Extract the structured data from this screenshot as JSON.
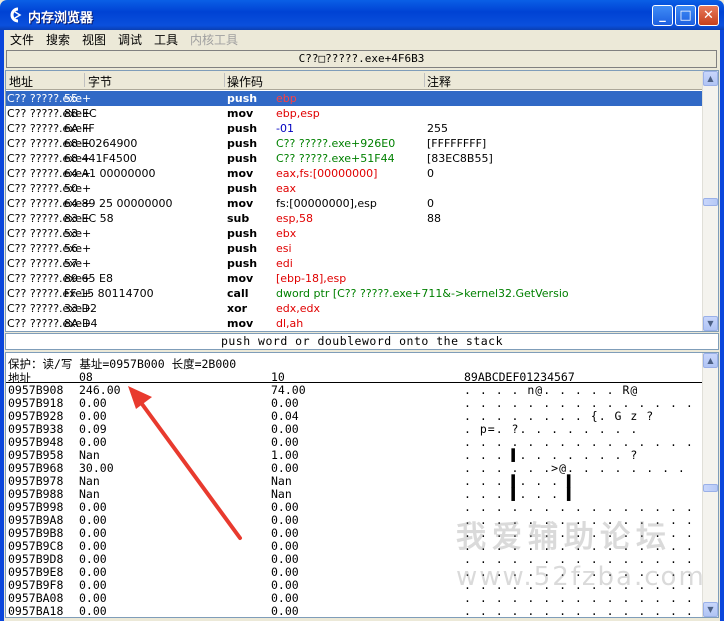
{
  "window": {
    "title": "内存浏览器",
    "minimize_glyph": "_",
    "maximize_glyph": "□",
    "close_glyph": "✕"
  },
  "menu": [
    "文件",
    "搜索",
    "视图",
    "调试",
    "工具",
    "内核工具"
  ],
  "address_bar": "C??□?????.exe+4F6B3",
  "disasm": {
    "headers": {
      "address": "地址",
      "bytes": "字节",
      "opcode": "操作码",
      "comment": "注释"
    },
    "rows": [
      {
        "addr": "C?? ?????.exe+",
        "bytes": "55",
        "op": "push",
        "args": "ebp",
        "comment": ""
      },
      {
        "addr": "C?? ?????.exe+",
        "bytes": "8B EC",
        "op": "mov",
        "args": "ebp,esp",
        "comment": ""
      },
      {
        "addr": "C?? ?????.exe+",
        "bytes": "6A FF",
        "op": "push",
        "args": "-01",
        "comment": "255"
      },
      {
        "addr": "C?? ?????.exe+",
        "bytes": "68 E0264900",
        "op": "push",
        "args": "C?? ?????.exe+926E0",
        "comment": "[FFFFFFFF]"
      },
      {
        "addr": "C?? ?????.exe+",
        "bytes": "68 441F4500",
        "op": "push",
        "args": "C?? ?????.exe+51F44",
        "comment": "[83EC8B55]"
      },
      {
        "addr": "C?? ?????.exe+",
        "bytes": "64 A1 00000000",
        "op": "mov",
        "args": "eax,fs:[00000000]",
        "comment": "0"
      },
      {
        "addr": "C?? ?????.exe+",
        "bytes": "50",
        "op": "push",
        "args": "eax",
        "comment": ""
      },
      {
        "addr": "C?? ?????.exe+",
        "bytes": "64 89 25 00000000",
        "op": "mov",
        "args": "fs:[00000000],esp",
        "comment": "0"
      },
      {
        "addr": "C?? ?????.exe+",
        "bytes": "83 EC 58",
        "op": "sub",
        "args": "esp,58",
        "comment": "88"
      },
      {
        "addr": "C?? ?????.exe+",
        "bytes": "53",
        "op": "push",
        "args": "ebx",
        "comment": ""
      },
      {
        "addr": "C?? ?????.exe+",
        "bytes": "56",
        "op": "push",
        "args": "esi",
        "comment": ""
      },
      {
        "addr": "C?? ?????.exe+",
        "bytes": "57",
        "op": "push",
        "args": "edi",
        "comment": ""
      },
      {
        "addr": "C?? ?????.exe+",
        "bytes": "89 65 E8",
        "op": "mov",
        "args": "[ebp-18],esp",
        "comment": ""
      },
      {
        "addr": "C?? ?????.exe+",
        "bytes": "FF 15 80114700",
        "op": "call",
        "args": "dword ptr [C?? ?????.exe+711&->kernel32.GetVersio",
        "comment": ""
      },
      {
        "addr": "C?? ?????.exe+",
        "bytes": "33 D2",
        "op": "xor",
        "args": "edx,edx",
        "comment": ""
      },
      {
        "addr": "C?? ?????.exe+",
        "bytes": "8A D4",
        "op": "mov",
        "args": "dl,ah",
        "comment": ""
      }
    ]
  },
  "description": "push word or doubleword onto the stack",
  "hex": {
    "protection": "保护：读/写   基址=0957B000 长度=2B000",
    "headers": {
      "address": "地址",
      "col1": "08",
      "col2": "10",
      "ascii": "89ABCDEF01234567"
    },
    "rows": [
      {
        "addr": "0957B908",
        "v1": "246.00",
        "v2": "74.00",
        "ascii": ". . . . n@. . . . . R@"
      },
      {
        "addr": "0957B918",
        "v1": "0.00",
        "v2": "0.00",
        "ascii": ". . . . . . . . . . . . . . . ."
      },
      {
        "addr": "0957B928",
        "v1": "0.00",
        "v2": "0.04",
        "ascii": ". . . . . . . . {. G z ?"
      },
      {
        "addr": "0957B938",
        "v1": "0.09",
        "v2": "0.00",
        "ascii": ".  p=. ?. . . . . . . ."
      },
      {
        "addr": "0957B948",
        "v1": "0.00",
        "v2": "0.00",
        "ascii": ". . . . . . . . . . . . . . . ."
      },
      {
        "addr": "0957B958",
        "v1": "Nan",
        "v2": "1.00",
        "ascii": ". . .  ▌. . . . . . . ?"
      },
      {
        "addr": "0957B968",
        "v1": "30.00",
        "v2": "0.00",
        "ascii": ". . . . . .>@. . . . . . . ."
      },
      {
        "addr": "0957B978",
        "v1": "Nan",
        "v2": "Nan",
        "ascii": ". . .  ▌. . .     ▌"
      },
      {
        "addr": "0957B988",
        "v1": "Nan",
        "v2": "Nan",
        "ascii": ". . .  ▌. . .     ▌"
      },
      {
        "addr": "0957B998",
        "v1": "0.00",
        "v2": "0.00",
        "ascii": ". . . . . . . . . . . . . . . ."
      },
      {
        "addr": "0957B9A8",
        "v1": "0.00",
        "v2": "0.00",
        "ascii": ". . . . . . . . . . . . . . . ."
      },
      {
        "addr": "0957B9B8",
        "v1": "0.00",
        "v2": "0.00",
        "ascii": ". . . . . . . . . . . . . . . ."
      },
      {
        "addr": "0957B9C8",
        "v1": "0.00",
        "v2": "0.00",
        "ascii": ". . . . . . . . . . . . . . . ."
      },
      {
        "addr": "0957B9D8",
        "v1": "0.00",
        "v2": "0.00",
        "ascii": ". . . . . . . . . . . . . . . ."
      },
      {
        "addr": "0957B9E8",
        "v1": "0.00",
        "v2": "0.00",
        "ascii": ". . . . . . . . . . . . . . . ."
      },
      {
        "addr": "0957B9F8",
        "v1": "0.00",
        "v2": "0.00",
        "ascii": ". . . . . . . . . . . . . . . ."
      },
      {
        "addr": "0957BA08",
        "v1": "0.00",
        "v2": "0.00",
        "ascii": ". . . . . . . . . . . . . . . ."
      },
      {
        "addr": "0957BA18",
        "v1": "0.00",
        "v2": "0.00",
        "ascii": ". . . . . . . . . . . . . . . ."
      }
    ]
  },
  "watermark": {
    "text": "我爱辅助论坛",
    "url": "www.52fzba.com"
  },
  "colors": {
    "titlebar": "#0042d4",
    "selection": "#3169c6",
    "register": "#e00000",
    "address_ref": "#008000",
    "annotation_arrow": "#e83a2e"
  }
}
